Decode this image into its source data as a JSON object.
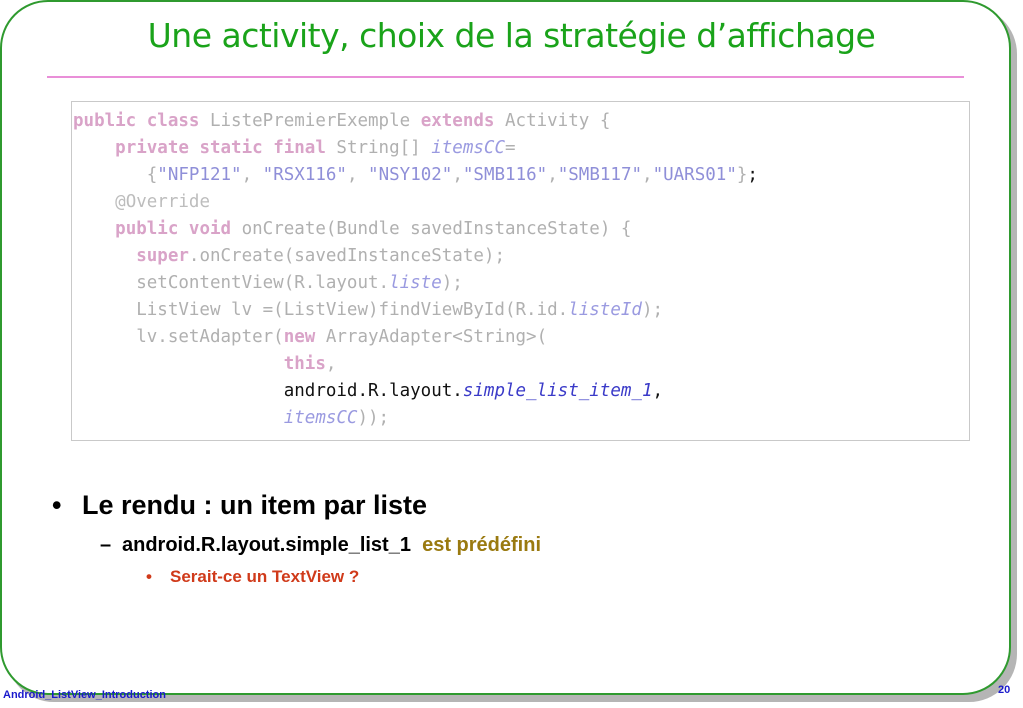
{
  "slide": {
    "title": "Une activity, choix de la stratégie d’affichage",
    "footer_label": "Android_ListView_Introduction",
    "page_number": "20"
  },
  "code": {
    "l1": [
      "public class",
      " ListePremierExemple ",
      "extends",
      " Activity {"
    ],
    "l2": [
      "    ",
      "private static final",
      " String[] ",
      "itemsCC",
      "="
    ],
    "l3": [
      "       {",
      "\"NFP121\"",
      ", ",
      "\"RSX116\"",
      ", ",
      "\"NSY102\"",
      ",",
      "\"SMB116\"",
      ",",
      "\"SMB117\"",
      ",",
      "\"UARS01\"",
      "}",
      ";"
    ],
    "l4": [
      "    ",
      "@Override"
    ],
    "l5": [
      "    ",
      "public void",
      " onCreate(Bundle savedInstanceState) {"
    ],
    "l6": [
      "      ",
      "super",
      ".onCreate(savedInstanceState);"
    ],
    "l7": [
      "      setContentView(R.layout.",
      "liste",
      ");"
    ],
    "l8": [
      "      ListView lv =(ListView)findViewById(R.id.",
      "listeId",
      ");"
    ],
    "l9": [
      "      lv.setAdapter(",
      "new",
      " ArrayAdapter<String>("
    ],
    "l10": [
      "                    ",
      "this",
      ","
    ],
    "l11": [
      "                    ",
      "android.R.layout.",
      "simple_list_item_1",
      ","
    ],
    "l12": [
      "                    ",
      "itemsCC",
      "));"
    ]
  },
  "bullets": {
    "level1": "Le rendu : un item par liste",
    "level2_code": "android.R.layout.simple_list_1",
    "level2_text": "est prédéfini",
    "level3": "Serait-ce un TextView ?",
    "dot": "•",
    "dash": "–"
  }
}
